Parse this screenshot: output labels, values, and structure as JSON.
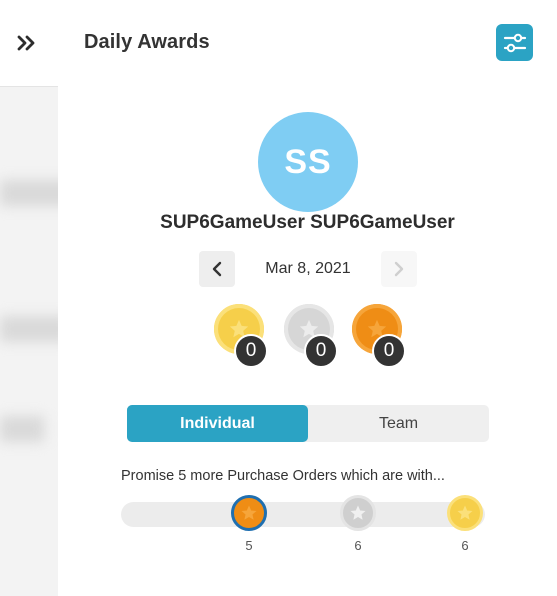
{
  "panel": {
    "title": "Daily Awards"
  },
  "user": {
    "initials": "SS",
    "name": "SUP6GameUser SUP6GameUser"
  },
  "date_nav": {
    "date": "Mar 8, 2021"
  },
  "medals": [
    {
      "type": "gold",
      "count": "0"
    },
    {
      "type": "silver",
      "count": "0"
    },
    {
      "type": "bronze",
      "count": "0"
    }
  ],
  "tabs": {
    "individual": "Individual",
    "team": "Team",
    "selected": "individual"
  },
  "goal": {
    "text": "Promise 5 more Purchase Orders which are with...",
    "thresholds": [
      {
        "tier": "bronze",
        "label": "5"
      },
      {
        "tier": "silver",
        "label": "6"
      },
      {
        "tier": "gold",
        "label": "6"
      }
    ]
  },
  "icons": {
    "collapse": "double-chevron-right-icon",
    "filter": "sliders-icon",
    "prev": "chevron-left-icon",
    "next": "chevron-right-icon",
    "medal": "star-icon"
  },
  "colors": {
    "accent": "#2ba3c4",
    "avatar": "#7fcdf3",
    "gold": "#f6cf4a",
    "silver": "#d6d6d6",
    "bronze": "#ef8d15",
    "count_badge": "#333333"
  }
}
